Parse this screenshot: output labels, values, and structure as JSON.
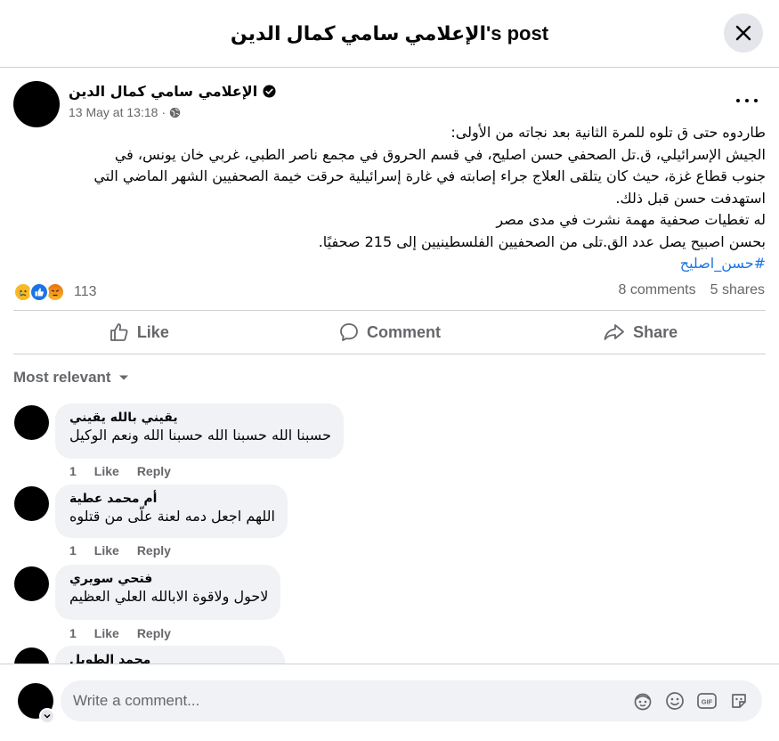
{
  "header": {
    "title": "الإعلامي سامي كمال الدين's post"
  },
  "post": {
    "author": "الإعلامي سامي كمال الدين",
    "timestamp": "13 May at 13:18",
    "audience_separator": "·",
    "lines": [
      "طاردوه حتى ق تلوه للمرة الثانية بعد نجاته من الأولى:",
      " الجيش الإسرائيلي، ق.تل الصحفي حسن اصليح، في قسم الحروق في مجمع  ناصر الطبي، غربي خان يونس، في",
      "جنوب قطاع غزة، حيث كان يتلقى العلاج جراء إصابته في غارة إسرائيلية حرقت خيمة الصحفيين الشهر الماضي التي",
      "استهدفت حسن  قبل ذلك.",
      "له تغطيات صحفية مهمة نشرت في مدى مصر",
      "بحسن اصبيح يصل عدد الق.تلى من الصحفيين الفلسطينيين إلى 215 صحفيًا."
    ],
    "hashtag": "#حسن_اصليح",
    "reaction_count": "113",
    "comments_count": "8 comments",
    "shares_count": "5 shares"
  },
  "actions": {
    "like": "Like",
    "comment": "Comment",
    "share": "Share"
  },
  "sort_label": "Most relevant",
  "comments": [
    {
      "name": "يقيني بالله يقيني",
      "text": "حسبنا الله حسبنا الله حسبنا الله ونعم الوكيل",
      "count": "1",
      "like": "Like",
      "reply": "Reply"
    },
    {
      "name": "أم محمد عطية",
      "text": "اللهم اجعل دمه لعنة علّى من قتلوه",
      "count": "1",
      "like": "Like",
      "reply": "Reply"
    },
    {
      "name": "فتحي سويري",
      "text": "لاحول ولاقوة الابالله العلي العظيم",
      "count": "1",
      "like": "Like",
      "reply": "Reply"
    },
    {
      "name": "محمد الطويل"
    }
  ],
  "composer": {
    "placeholder": "Write a comment..."
  },
  "colors": {
    "link": "#1b74e4",
    "muted": "#65676b",
    "bubble": "#f0f2f5",
    "divider": "#ced0d4"
  }
}
